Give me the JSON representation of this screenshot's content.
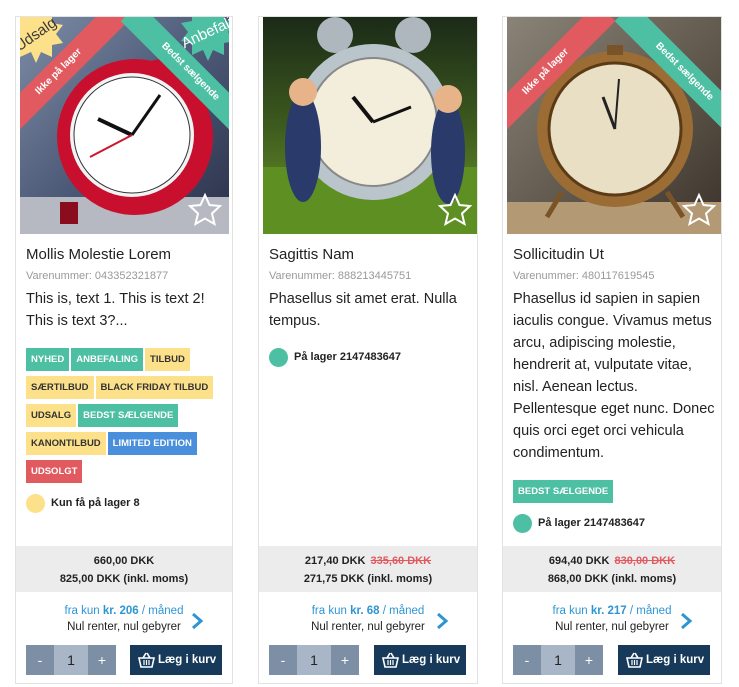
{
  "products": [
    {
      "title": "Mollis Molestie Lorem",
      "sku": "Varenummer: 043352321877",
      "description": "This is, text 1.   This is text 2! This is text 3?...",
      "ribbon_left": "Ikke på lager",
      "ribbon_right": "Bedst sælgende",
      "badge_sale": "Udsalg",
      "badge_rec": "Anbefaling",
      "tags": [
        {
          "label": "NYHED",
          "color": "green"
        },
        {
          "label": "ANBEFALING",
          "color": "green"
        },
        {
          "label": "TILBUD",
          "color": "yellow"
        },
        {
          "label": "SÆRTILBUD",
          "color": "yellow"
        },
        {
          "label": "BLACK FRIDAY TILBUD",
          "color": "yellow"
        },
        {
          "label": "UDSALG",
          "color": "yellow"
        },
        {
          "label": "BEDST SÆLGENDE",
          "color": "green"
        },
        {
          "label": "KANONTILBUD",
          "color": "yellow"
        },
        {
          "label": "LIMITED EDITION",
          "color": "blue"
        },
        {
          "label": "UDSOLGT",
          "color": "red"
        }
      ],
      "stock_text": "Kun få på lager 8",
      "stock_color": "yellow",
      "price": "660,00 DKK",
      "old_price": "",
      "price_incl": "825,00 DKK (inkl. moms)",
      "finance_prefix": "fra kun",
      "finance_amount": "kr. 206",
      "finance_suffix": "/ måned",
      "finance_note": "Nul renter, nul gebyrer",
      "qty": "1",
      "minus": "-",
      "plus": "+",
      "cart_label": "Læg i kurv"
    },
    {
      "title": "Sagittis Nam",
      "sku": "Varenummer: 888213445751",
      "description": "Phasellus sit amet erat. Nulla tempus.",
      "ribbon_left": "",
      "ribbon_right": "",
      "tags": [],
      "stock_text": "På lager 2147483647",
      "stock_color": "green",
      "price": "217,40 DKK",
      "old_price": "335,60 DKK",
      "price_incl": "271,75 DKK (inkl. moms)",
      "finance_prefix": "fra kun",
      "finance_amount": "kr. 68",
      "finance_suffix": "/ måned",
      "finance_note": "Nul renter, nul gebyrer",
      "qty": "1",
      "minus": "-",
      "plus": "+",
      "cart_label": "Læg i kurv"
    },
    {
      "title": "Sollicitudin Ut",
      "sku": "Varenummer: 480117619545",
      "description": "Phasellus id sapien in sapien iaculis congue. Vivamus metus arcu, adipiscing molestie, hendrerit at, vulputate vitae, nisl. Aenean lectus. Pellentesque eget nunc. Donec quis orci eget orci vehicula condimentum.",
      "ribbon_left": "Ikke på lager",
      "ribbon_right": "Bedst sælgende",
      "tags": [
        {
          "label": "BEDST SÆLGENDE",
          "color": "green"
        }
      ],
      "stock_text": "På lager 2147483647",
      "stock_color": "green",
      "price": "694,40 DKK",
      "old_price": "830,00 DKK",
      "price_incl": "868,00 DKK (inkl. moms)",
      "finance_prefix": "fra kun",
      "finance_amount": "kr. 217",
      "finance_suffix": "/ måned",
      "finance_note": "Nul renter, nul gebyrer",
      "qty": "1",
      "minus": "-",
      "plus": "+",
      "cart_label": "Læg i kurv"
    }
  ],
  "icons": {
    "favorite": "star-outline-icon",
    "cart": "basket-icon",
    "next": "chevron-right-icon"
  },
  "colors": {
    "green": "#4dbfa3",
    "yellow": "#fde08a",
    "red": "#e05a5f",
    "blue": "#4a8fdc",
    "navy": "#173a5a",
    "link": "#2e95d3"
  }
}
